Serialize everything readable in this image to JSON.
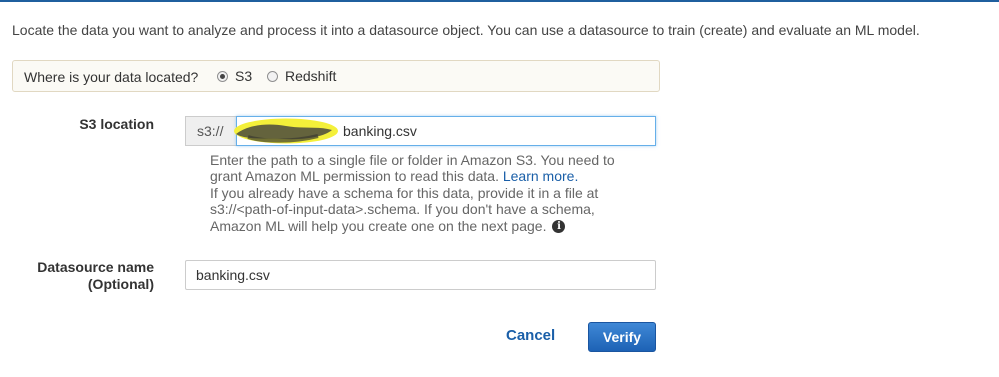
{
  "intro": "Locate the data you want to analyze and process it into a datasource object. You can use a datasource to train (create) and evaluate an ML model.",
  "location": {
    "question": "Where is your data located?",
    "options": [
      {
        "label": "S3",
        "selected": true
      },
      {
        "label": "Redshift",
        "selected": false
      }
    ]
  },
  "s3": {
    "label": "S3 location",
    "prefix": "s3://",
    "value": "banking.csv",
    "help": {
      "text1": "Enter the path to a single file or folder in Amazon S3. You need to grant Amazon ML permission to read this data.",
      "learn_more": "Learn more.",
      "text2": "If you already have a schema for this data, provide it in a file at s3://<path-of-input-data>.schema. If you don't have a schema, Amazon ML will help you create one on the next page."
    },
    "info_icon": "info-icon"
  },
  "datasource": {
    "label_line1": "Datasource name",
    "label_line2": "(Optional)",
    "value": "banking.csv"
  },
  "actions": {
    "cancel": "Cancel",
    "verify": "Verify"
  },
  "colors": {
    "accent": "#1f5f9e",
    "primary_button": "#2a70c2",
    "link": "#1a5fa8",
    "highlight": "#f4f03a"
  }
}
